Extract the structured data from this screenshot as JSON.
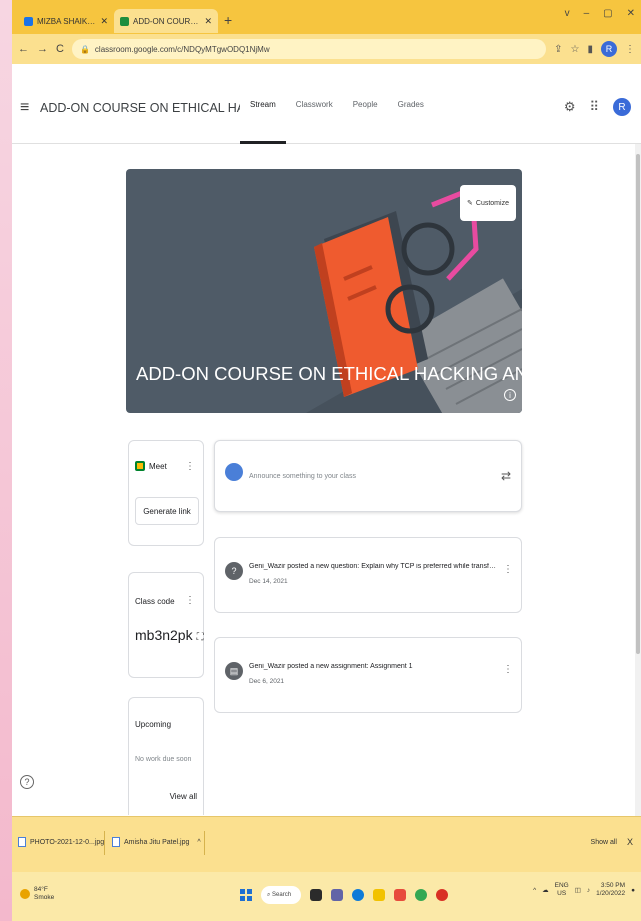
{
  "browser": {
    "tabs": [
      {
        "title": "MIZBA SHAIKH added a private",
        "active": false,
        "favicon_color": "#1a73e8"
      },
      {
        "title": "ADD-ON COURSE ON ETHICAL",
        "active": true,
        "favicon_color": "#1e8e3e"
      }
    ],
    "window_controls": [
      "v",
      "–",
      "▢",
      "✕"
    ],
    "url": "classroom.google.com/c/NDQyMTgwODQ1NjMw",
    "profile_initial": "R"
  },
  "header": {
    "course_title": "ADD-ON COURSE ON ETHICAL HACKING AND I...",
    "tabs": [
      "Stream",
      "Classwork",
      "People",
      "Grades"
    ],
    "active_tab": "Stream",
    "avatar_initial": "R"
  },
  "banner": {
    "title": "ADD-ON COURSE ON ETHICAL HACKING AND INTER...",
    "customize_label": "Customize",
    "background": "#4f5b67"
  },
  "meet": {
    "label": "Meet",
    "generate_link": "Generate link"
  },
  "class_code": {
    "label": "Class code",
    "code": "mb3n2pk"
  },
  "upcoming": {
    "title": "Upcoming",
    "empty": "No work due soon",
    "view_all": "View all"
  },
  "stream": {
    "announce_placeholder": "Announce something to your class",
    "posts": [
      {
        "icon": "question-icon",
        "text": "Geni_Wazir posted a new question: Explain why TCP is preferred while transferring a file fro...",
        "date": "Dec 14, 2021"
      },
      {
        "icon": "assignment-icon",
        "text": "Geni_Wazir posted a new assignment: Assignment 1",
        "date": "Dec 6, 2021"
      }
    ]
  },
  "downloads": {
    "items": [
      "PHOTO-2021-12-0...jpg",
      "Amisha Jitu Patel.jpg"
    ],
    "show_all": "Show all",
    "close": "X"
  },
  "taskbar": {
    "temperature": "84°F",
    "condition": "Smoke",
    "search": "Search",
    "language": "ENG",
    "region": "US",
    "time": "3:50 PM",
    "date": "1/20/2022"
  }
}
